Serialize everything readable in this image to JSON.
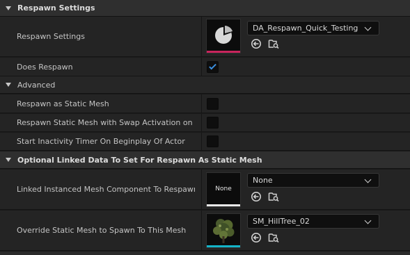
{
  "categories": {
    "respawn_settings": "Respawn Settings",
    "advanced": "Advanced",
    "optional_linked": "Optional Linked Data To Set For Respawn As Static Mesh"
  },
  "rows": {
    "respawn_settings": {
      "label": "Respawn Settings",
      "asset": "DA_Respawn_Quick_Testing",
      "thumb_accent": "#c8245c"
    },
    "does_respawn": {
      "label": "Does Respawn",
      "checked": true
    },
    "respawn_as_static_mesh": {
      "label": "Respawn as Static Mesh",
      "checked": false
    },
    "respawn_swap_activation": {
      "label": "Respawn Static Mesh with  Swap Activation on O...",
      "checked": false
    },
    "start_inactivity_timer": {
      "label": "Start Inactivity Timer On Beginplay Of Actor",
      "checked": false
    },
    "linked_instanced_mesh": {
      "label": "Linked Instanced Mesh Component To Respawn...",
      "asset": "None",
      "thumb_text": "None",
      "thumb_accent": "#e8e8e8"
    },
    "override_static_mesh": {
      "label": "Override Static Mesh to Spawn To This Mesh",
      "asset": "SM_HillTree_02",
      "thumb_accent": "#14b4c8"
    }
  },
  "icons": {
    "use_selected": "arrow-left-circle-icon",
    "browse": "browse-folder-icon",
    "collapse": "triangle-down-icon"
  },
  "colors": {
    "checkbox_tick": "#3b8fe0",
    "category_bg": "#2f2f2f",
    "row_bg": "#242424"
  }
}
